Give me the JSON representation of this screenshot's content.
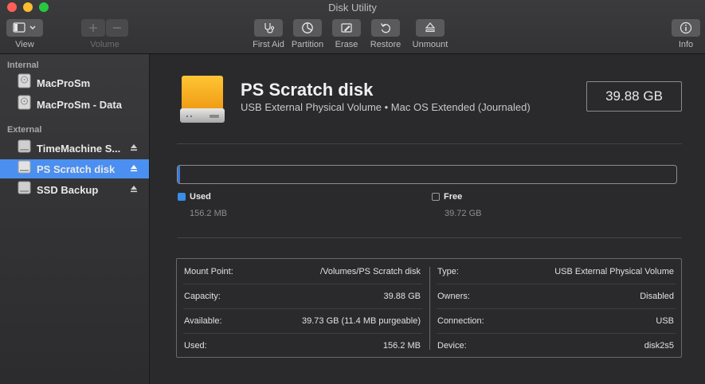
{
  "window": {
    "title": "Disk Utility"
  },
  "toolbar": {
    "view_label": "View",
    "volume_label": "Volume",
    "first_aid_label": "First Aid",
    "partition_label": "Partition",
    "erase_label": "Erase",
    "restore_label": "Restore",
    "unmount_label": "Unmount",
    "info_label": "Info",
    "icons": {
      "view": "sidebar-toggle-icon",
      "add": "plus-icon",
      "remove": "minus-icon",
      "first_aid": "stethoscope-icon",
      "partition": "pie-chart-icon",
      "erase": "erase-icon",
      "restore": "restore-arrow-icon",
      "unmount": "eject-icon",
      "info": "info-icon"
    }
  },
  "sidebar": {
    "internal_header": "Internal",
    "external_header": "External",
    "internal_items": [
      {
        "label": "MacProSm"
      },
      {
        "label": "MacProSm - Data"
      }
    ],
    "external_items": [
      {
        "label": "TimeMachine S...",
        "ejectable": true
      },
      {
        "label": "PS Scratch disk",
        "ejectable": true,
        "selected": true
      },
      {
        "label": "SSD Backup",
        "ejectable": true
      }
    ]
  },
  "disk": {
    "name": "PS Scratch disk",
    "description": "USB External Physical Volume • Mac OS Extended (Journaled)",
    "capacity": "39.88 GB",
    "used_fraction": 0.004
  },
  "legend": {
    "used_label": "Used",
    "used_value": "156.2 MB",
    "free_label": "Free",
    "free_value": "39.72 GB"
  },
  "info": {
    "left": [
      {
        "key": "Mount Point:",
        "value": "/Volumes/PS Scratch disk"
      },
      {
        "key": "Capacity:",
        "value": "39.88 GB"
      },
      {
        "key": "Available:",
        "value": "39.73 GB (11.4 MB purgeable)"
      },
      {
        "key": "Used:",
        "value": "156.2 MB"
      }
    ],
    "right": [
      {
        "key": "Type:",
        "value": "USB External Physical Volume"
      },
      {
        "key": "Owners:",
        "value": "Disabled"
      },
      {
        "key": "Connection:",
        "value": "USB"
      },
      {
        "key": "Device:",
        "value": "disk2s5"
      }
    ]
  },
  "colors": {
    "accent": "#4b8ff0",
    "used": "#3a8ee6",
    "disk_orange": "#f2a51a"
  }
}
